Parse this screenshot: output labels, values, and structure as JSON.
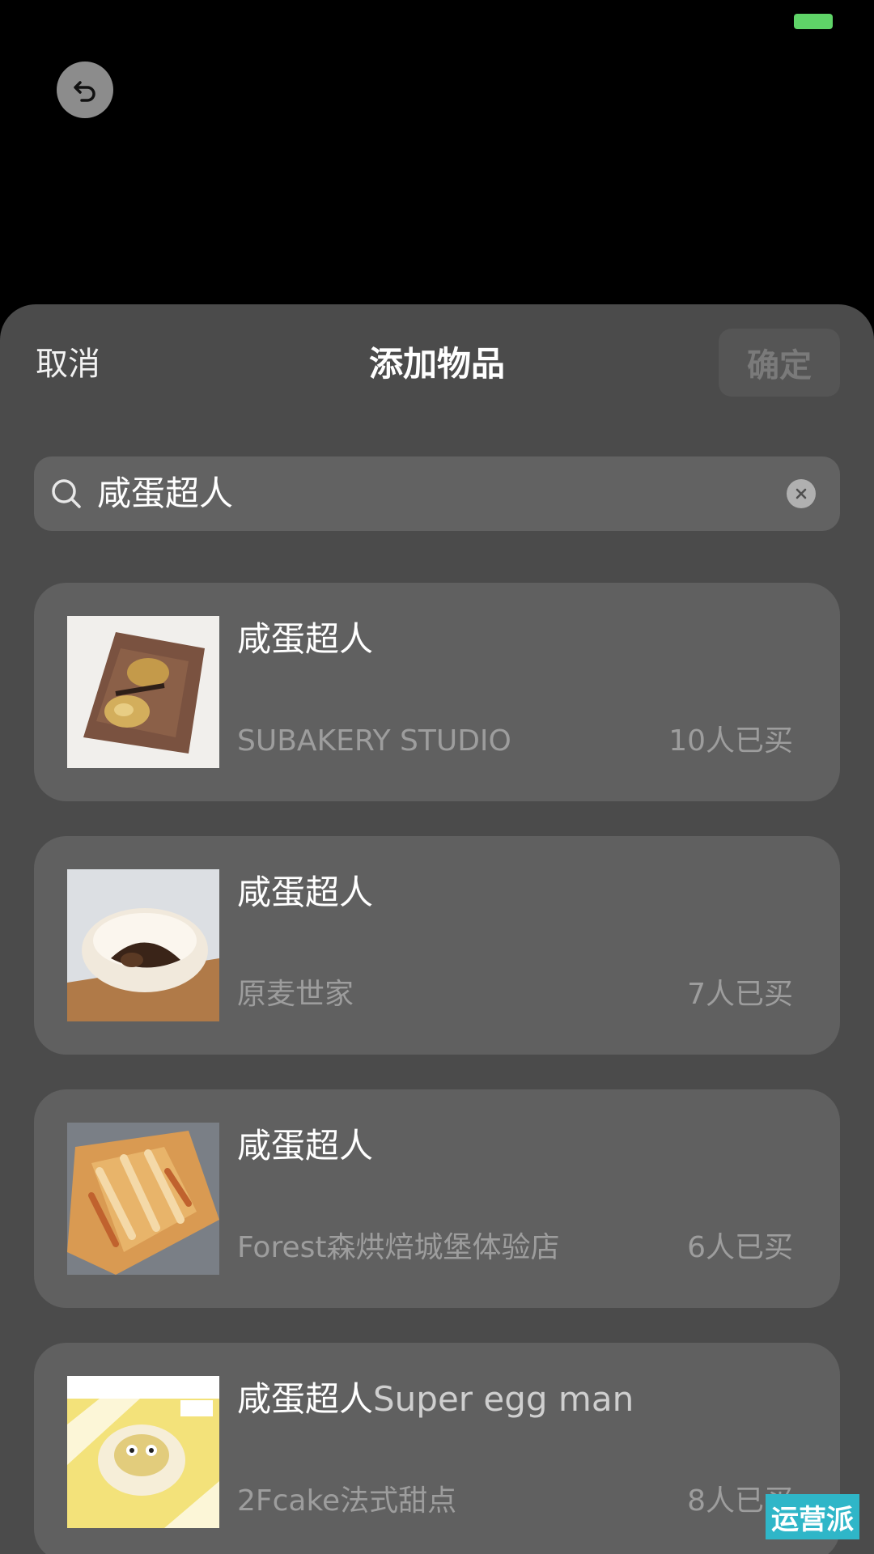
{
  "status_bar": {
    "battery_color": "#5fd468"
  },
  "top": {
    "back_icon": "undo-arrow-icon"
  },
  "sheet": {
    "cancel_label": "取消",
    "title": "添加物品",
    "confirm_label": "确定"
  },
  "search": {
    "value": "咸蛋超人",
    "search_icon": "search-icon",
    "clear_icon": "clear-icon"
  },
  "items": [
    {
      "name": "咸蛋超人",
      "name_en": "",
      "store": "SUBAKERY STUDIO",
      "buyers": "10人已买",
      "thumb": "bread-loaf-photo"
    },
    {
      "name": "咸蛋超人",
      "name_en": "",
      "store": "原麦世家",
      "buyers": "7人已买",
      "thumb": "bun-photo"
    },
    {
      "name": "咸蛋超人",
      "name_en": "",
      "store": "Forest森烘焙城堡体验店",
      "buyers": "6人已买",
      "thumb": "pastry-photo"
    },
    {
      "name": "咸蛋超人",
      "name_en": "Super egg man",
      "store": "2Fcake法式甜点",
      "buyers": "8人已买",
      "thumb": "cake-photo"
    }
  ],
  "watermark": {
    "text": "运营派"
  }
}
